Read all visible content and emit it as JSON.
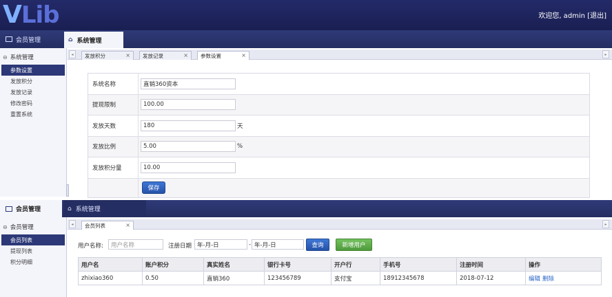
{
  "header": {
    "logo_text": "Lib",
    "logo_letter": "V",
    "user_text": "欢迎您, admin [退出]"
  },
  "top_panel": {
    "left_tab": "会员管理",
    "right_tab": "系统管理",
    "sidebar": {
      "group": "系统管理",
      "items": [
        "参数设置",
        "发放积分",
        "发放记录",
        "修改密码",
        "重置系统"
      ],
      "active_index": 0
    },
    "subtabs": [
      {
        "label": "发放积分"
      },
      {
        "label": "发放记录"
      },
      {
        "label": "参数设置"
      }
    ],
    "form": {
      "rows": [
        {
          "label": "系统名称",
          "value": "直销360资本",
          "unit": ""
        },
        {
          "label": "提现限制",
          "value": "100.00",
          "unit": ""
        },
        {
          "label": "发放天数",
          "value": "180",
          "unit": "天"
        },
        {
          "label": "发放比例",
          "value": "5.00",
          "unit": "%"
        },
        {
          "label": "发放积分量",
          "value": "10.00",
          "unit": ""
        }
      ],
      "save_label": "保存"
    }
  },
  "bottom_panel": {
    "left_tab": "会员管理",
    "right_tab": "系统管理",
    "sidebar": {
      "group": "会员管理",
      "items": [
        "会员列表",
        "提现列表",
        "积分明细"
      ],
      "active_index": 0
    },
    "subtabs": [
      {
        "label": "会员列表"
      }
    ],
    "search": {
      "username_label": "用户名称:",
      "username_placeholder": "用户名称",
      "date_label": "注册日期",
      "date_from": "年-月-日",
      "date_sep": "-",
      "date_to": "年-月-日",
      "query_label": "查询",
      "add_label": "新增用户"
    },
    "table": {
      "headers": [
        "用户名",
        "账户积分",
        "真实姓名",
        "银行卡号",
        "开户行",
        "手机号",
        "注册时间",
        "操作"
      ],
      "rows": [
        [
          "zhixiao360",
          "0.50",
          "直销360",
          "123456789",
          "支付宝",
          "18912345678",
          "2018-07-12"
        ]
      ],
      "actions": [
        "编辑",
        "删除"
      ]
    }
  }
}
